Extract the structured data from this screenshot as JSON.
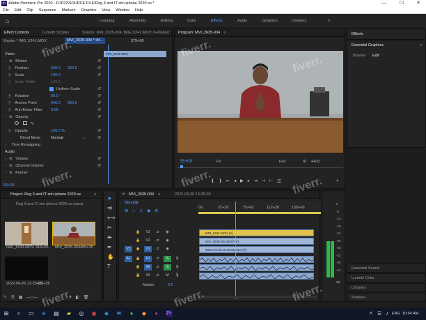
{
  "window": {
    "logo": "Pr",
    "title": "Adobe Premiere Pro 2020 - D:\\P22\\SOURCE FILE\\Rog 3 and IT sim iphone 2020 se *",
    "min": "—",
    "max": "☐",
    "close": "✕"
  },
  "menu": [
    "File",
    "Edit",
    "Clip",
    "Sequence",
    "Markers",
    "Graphics",
    "View",
    "Window",
    "Help"
  ],
  "workspaces": [
    "Learning",
    "Assembly",
    "Editing",
    "Color",
    "Effects",
    "Audio",
    "Graphics",
    "Libraries"
  ],
  "workspace_more": "»",
  "effect_controls": {
    "tabs": [
      "Effect Controls",
      "Lumetri Scopes",
      "Source: MVI_2635-004: IMG_5241.MOV: 0+00",
      "Aud"
    ],
    "menu_icon": "≡",
    "clip_selector": "Master * IMG_5241.MOV",
    "sequence_selector": "MVI_2635-004 * IM...",
    "timecode_mark": "375+00",
    "mini_clip": "IMG_5241.MOV",
    "video_label": "Video",
    "motion": "Motion",
    "position_label": "Position",
    "position_x": "540.0",
    "position_y": "360.0",
    "scale_label": "Scale",
    "scale_value": "100.0",
    "scale_width_label": "Scale Width",
    "scale_width_value": "100.0",
    "uniform_scale": "Uniform Scale",
    "rotation_label": "Rotation",
    "rotation_value": "90.0 °",
    "anchor_label": "Anchor Point",
    "anchor_x": "540.0",
    "anchor_y": "960.0",
    "antiflicker_label": "Anti-flicker Filter",
    "antiflicker_value": "0.00",
    "opacity_section": "Opacity",
    "opacity_label": "Opacity",
    "opacity_value": "100.0 %",
    "blend_label": "Blend Mode",
    "blend_value": "Normal",
    "time_remap": "Time Remapping",
    "audio_label": "Audio",
    "volume": "Volume",
    "channel_volume": "Channel Volume",
    "panner": "Panner",
    "timecode": "55+09"
  },
  "program": {
    "title": "Program: MVI_2635-004",
    "menu_icon": "≡",
    "timecode": "55+09",
    "fit": "Fit",
    "quality": "Full",
    "duration": "4+00"
  },
  "project": {
    "title": "Project: Rog 3 and IT sim iphone 2020 se",
    "menu_icon": "≡",
    "file": "Rog 3 and IT sim iphone 2020 se.prproj",
    "items": [
      {
        "name": "IMG_5241.MOV",
        "duration": "416+05"
      },
      {
        "name": "MVI_2635-004",
        "duration": "499+25"
      },
      {
        "name": "2022-04-26 13-25-05",
        "duration": "416+35"
      }
    ]
  },
  "timeline": {
    "title": "MVI_2635-004",
    "tab2": "2022-04-26 13-25-05",
    "menu_icon": "≡",
    "timecode": "55+08",
    "ruler": [
      "00",
      "37+20",
      "75+00",
      "112+20",
      "150+00"
    ],
    "video_tracks": [
      "V3",
      "V2",
      "V1"
    ],
    "audio_tracks": [
      "A1",
      "A2",
      "A3"
    ],
    "source_v": "V1",
    "source_a": "A1",
    "master_label": "Master",
    "master_value": "0.0",
    "clips": {
      "v3": "IMG_5241.MOV [V]",
      "v2": "MVI_2635-004.MOV [V]",
      "v1": "2022-04-26 13-25-05.mp4 [V]"
    }
  },
  "meter": {
    "scale": [
      "0",
      "-6",
      "-12",
      "-18",
      "-24",
      "-30",
      "-36",
      "-42",
      "-48",
      "-54"
    ],
    "db": "dB",
    "solo": "S",
    "solo2": "S"
  },
  "right_panels": {
    "effects_title": "Effects",
    "essential_graphics": "Essential Graphics",
    "menu_icon": "≡",
    "eg_tabs": [
      "Browse",
      "Edit"
    ],
    "essential_sound": "Essential Sound",
    "lumetri_color": "Lumetri Color",
    "libraries": "Libraries",
    "markers": "Markers"
  },
  "taskbar": {
    "language": "ENG",
    "time": "10:54 AM"
  },
  "watermark": "fiverr."
}
